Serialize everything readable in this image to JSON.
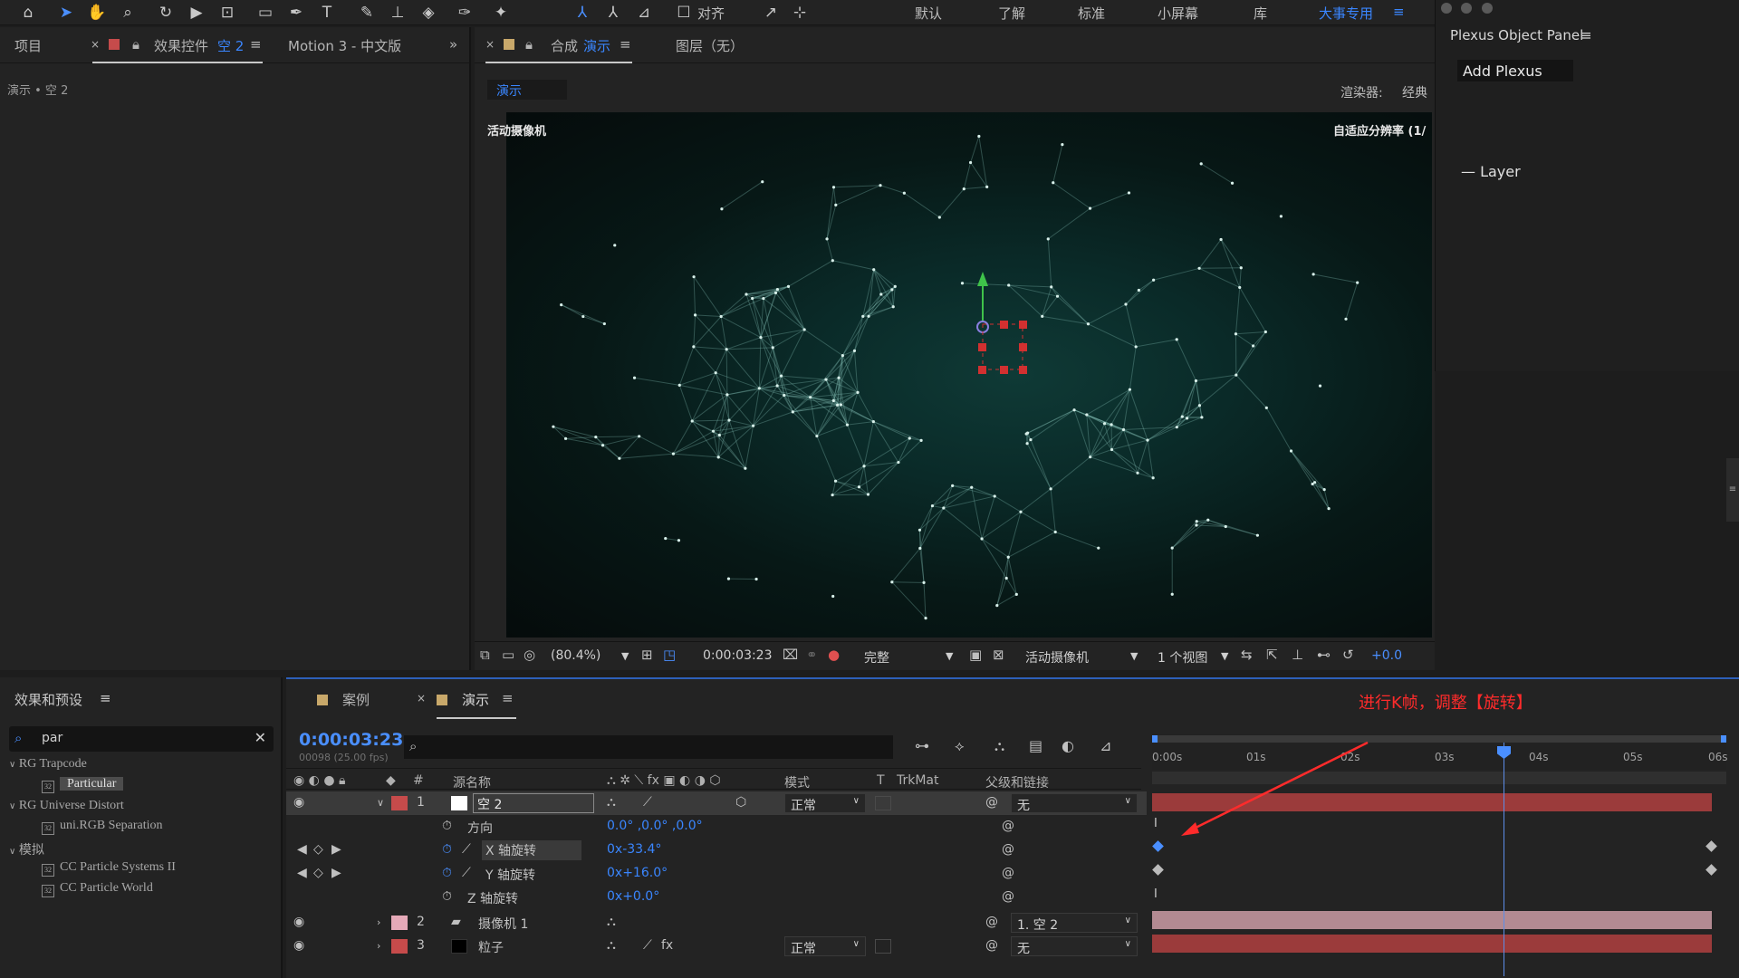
{
  "toolbar": {
    "tools": [
      "home-icon",
      "selection-icon",
      "hand-icon",
      "zoom-icon",
      "rotate-icon",
      "camera-icon",
      "pan-behind-icon",
      "rectangle-icon",
      "pen-icon",
      "text-icon",
      "brush-icon",
      "stamp-icon",
      "eraser-icon",
      "roto-icon",
      "puppet-icon",
      "axis-local-icon",
      "axis-world-icon",
      "axis-view-icon"
    ],
    "snap_label": "对齐",
    "workspaces": [
      "默认",
      "了解",
      "标准",
      "小屏幕",
      "库",
      "大事专用"
    ],
    "active_workspace": "大事专用"
  },
  "project_panel": {
    "tab_project": "项目",
    "tab_effect_controls_prefix": "效果控件",
    "tab_effect_controls_layer": "空 2",
    "tab_motion": "Motion 3 - 中文版",
    "breadcrumb": "演示 • 空 2"
  },
  "comp_panel": {
    "tab_comp_prefix": "合成",
    "tab_comp_name": "演示",
    "tab_layer": "图层（无）",
    "sub_tab": "演示",
    "renderer_label": "渲染器:",
    "renderer_value": "经典",
    "camera_label": "活动摄像机",
    "resolution_label": "自适应分辨率 (1/"
  },
  "viewer_bar": {
    "zoom": "(80.4%)",
    "timecode": "0:00:03:23",
    "quality": "完整",
    "camera": "活动摄像机",
    "views": "1 个视图",
    "exposure": "+0.0"
  },
  "plexus": {
    "title": "Plexus Object Panel",
    "add_button": "Add Plexus",
    "layer_item": "— Layer"
  },
  "effects": {
    "title": "效果和预设",
    "search": "par",
    "tree": [
      {
        "type": "group",
        "label": "RG Trapcode"
      },
      {
        "type": "item",
        "label": "Particular",
        "selected": true
      },
      {
        "type": "group",
        "label": "RG Universe Distort"
      },
      {
        "type": "item",
        "label": "uni.RGB Separation"
      },
      {
        "type": "group",
        "label": "模拟"
      },
      {
        "type": "item",
        "label": "CC Particle Systems II"
      },
      {
        "type": "item",
        "label": "CC Particle World"
      }
    ]
  },
  "timeline": {
    "tab_case": "案例",
    "tab_demo": "演示",
    "timecode": "0:00:03:23",
    "fps": "00098 (25.00 fps)",
    "columns": {
      "num": "#",
      "source": "源名称",
      "mode": "模式",
      "t": "T",
      "trkmat": "TrkMat",
      "parent": "父级和链接"
    },
    "layers": [
      {
        "num": "1",
        "name": "空 2",
        "mode": "正常",
        "parent": "无",
        "label_color": "#c64b4b",
        "swatch": "#ffffff"
      },
      {
        "num": "2",
        "name": "摄像机 1",
        "parent": "1. 空 2",
        "label_color": "#e5a9b8"
      },
      {
        "num": "3",
        "name": "粒子",
        "mode": "正常",
        "parent": "无",
        "label_color": "#c64b4b",
        "swatch": "#000000"
      }
    ],
    "properties": [
      {
        "name": "方向",
        "value": "0.0° ,0.0° ,0.0°"
      },
      {
        "name": "X 轴旋转",
        "value": "0x-33.4°"
      },
      {
        "name": "Y 轴旋转",
        "value": "0x+16.0°"
      },
      {
        "name": "Z 轴旋转",
        "value": "0x+0.0°"
      }
    ],
    "ruler_ticks": [
      "0:00s",
      "01s",
      "02s",
      "03s",
      "04s",
      "05s",
      "06s"
    ],
    "annotation": "进行K帧，调整【旋转】"
  }
}
